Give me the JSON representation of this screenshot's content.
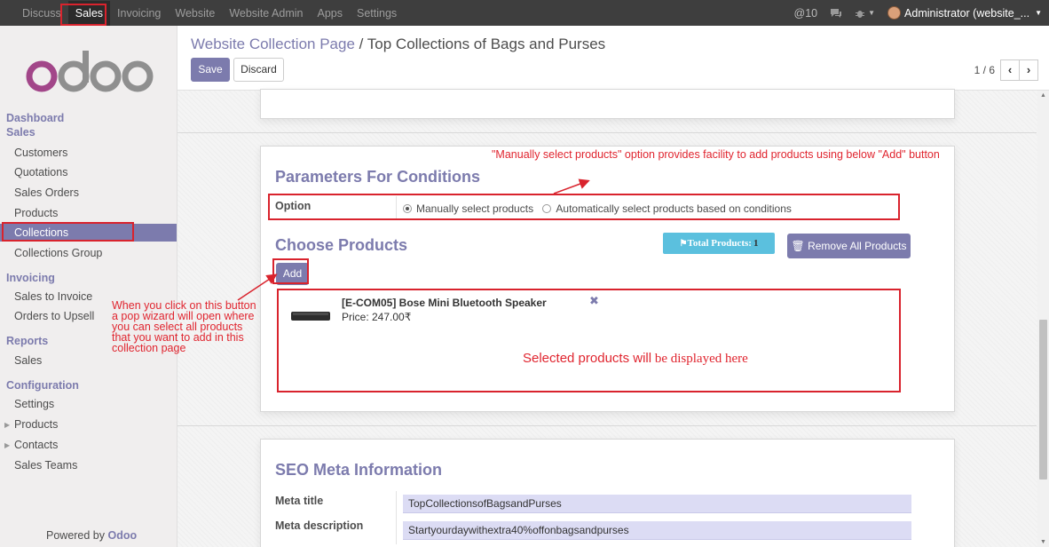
{
  "topbar": {
    "menu": [
      "Discuss",
      "Sales",
      "Invoicing",
      "Website",
      "Website Admin",
      "Apps",
      "Settings"
    ],
    "active": "Sales",
    "mentions": "@10",
    "user": "Administrator (website_..."
  },
  "sidebar": {
    "logo_text": "odoo",
    "dashboard": "Dashboard",
    "sales_section": "Sales",
    "sales_items": [
      "Customers",
      "Quotations",
      "Sales Orders",
      "Products",
      "Collections",
      "Collections Group"
    ],
    "invoicing_section": "Invoicing",
    "invoicing_items": [
      "Sales to Invoice",
      "Orders to Upsell"
    ],
    "reports_section": "Reports",
    "reports_items": [
      "Sales"
    ],
    "config_section": "Configuration",
    "config_items": [
      "Settings",
      "Products",
      "Contacts",
      "Sales Teams"
    ],
    "powered_by": "Powered by",
    "powered_brand": "Odoo"
  },
  "control_panel": {
    "breadcrumb_parent": "Website Collection Page",
    "breadcrumb_sep": "/",
    "breadcrumb_current": "Top Collections of Bags and Purses",
    "save_label": "Save",
    "discard_label": "Discard",
    "pager": "1 / 6"
  },
  "form": {
    "params_title": "Parameters For Conditions",
    "option_label": "Option",
    "option_manual": "Manually select products",
    "option_auto": "Automatically select products based on conditions",
    "choose_title": "Choose Products",
    "total_label": "Total Products:",
    "total_count": "1",
    "remove_all_label": "Remove All Products",
    "add_label": "Add",
    "product_name": "[E-COM05] Bose Mini Bluetooth Speaker",
    "product_price": "Price: 247.00₹",
    "seo_title": "SEO Meta Information",
    "meta_title_label": "Meta title",
    "meta_title_value": "TopCollectionsofBagsandPurses",
    "meta_desc_label": "Meta description",
    "meta_desc_value": "Startyourdaywithextra40%offonbagsandpurses"
  },
  "annotations": {
    "top_note": "\"Manually select products\" option provides facility to add products using below \"Add\" button",
    "add_note": "When you click on this button a pop wizard will open where you can select all products that you want to add in this collection page",
    "selected_note_a": "Selected products will",
    "selected_note_b": " be displayed here"
  },
  "colors": {
    "brand": "#7c7bad",
    "annotation": "#d9232d",
    "info_badge": "#5bc0de"
  }
}
